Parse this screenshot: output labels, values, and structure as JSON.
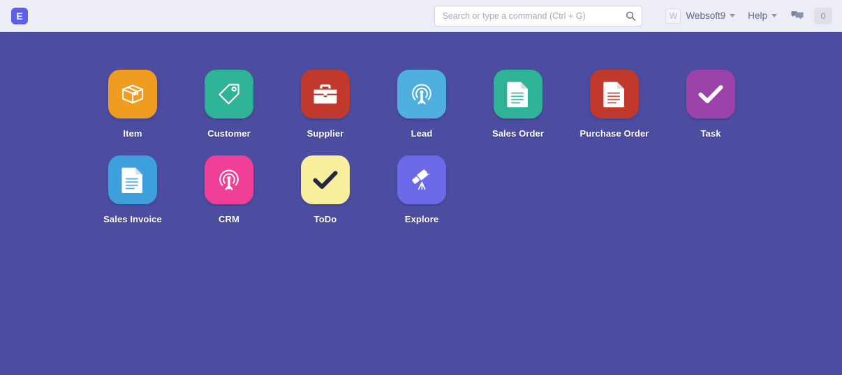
{
  "navbar": {
    "logo_text": "E",
    "logo_icon": "erpnext-logo-icon",
    "search": {
      "placeholder": "Search or type a command (Ctrl + G)",
      "value": "",
      "icon": "search-icon"
    },
    "avatar_initial": "W",
    "user_name": "Websoft9",
    "help_label": "Help",
    "chat_icon": "chat-bubbles-icon",
    "notification_count": "0"
  },
  "desktop": {
    "background_color": "#4c4ca0",
    "apps": [
      {
        "label": "Item",
        "icon": "box-package-icon",
        "color": "#ef9d20",
        "icon_style": "outline"
      },
      {
        "label": "Customer",
        "icon": "price-tag-icon",
        "color": "#2eb397",
        "icon_style": "outline"
      },
      {
        "label": "Supplier",
        "icon": "briefcase-icon",
        "color": "#c0392b",
        "icon_style": "solid"
      },
      {
        "label": "Lead",
        "icon": "lead-person-icon",
        "color": "#4fb0e0",
        "icon_style": "outline"
      },
      {
        "label": "Sales Order",
        "icon": "document-icon",
        "color": "#2eb397",
        "icon_style": "solid"
      },
      {
        "label": "Purchase Order",
        "icon": "document-icon",
        "color": "#c0392b",
        "icon_style": "solid"
      },
      {
        "label": "Task",
        "icon": "check-icon",
        "color": "#9b43ab",
        "icon_style": "solid"
      },
      {
        "label": "Sales Invoice",
        "icon": "document-icon",
        "color": "#3da0dc",
        "icon_style": "solid"
      },
      {
        "label": "CRM",
        "icon": "lead-person-icon",
        "color": "#ef3f96",
        "icon_style": "outline"
      },
      {
        "label": "ToDo",
        "icon": "check-icon",
        "color": "#f7ef9e",
        "icon_style": "solid-dark"
      },
      {
        "label": "Explore",
        "icon": "telescope-icon",
        "color": "#6a6ae8",
        "icon_style": "solid"
      }
    ]
  }
}
